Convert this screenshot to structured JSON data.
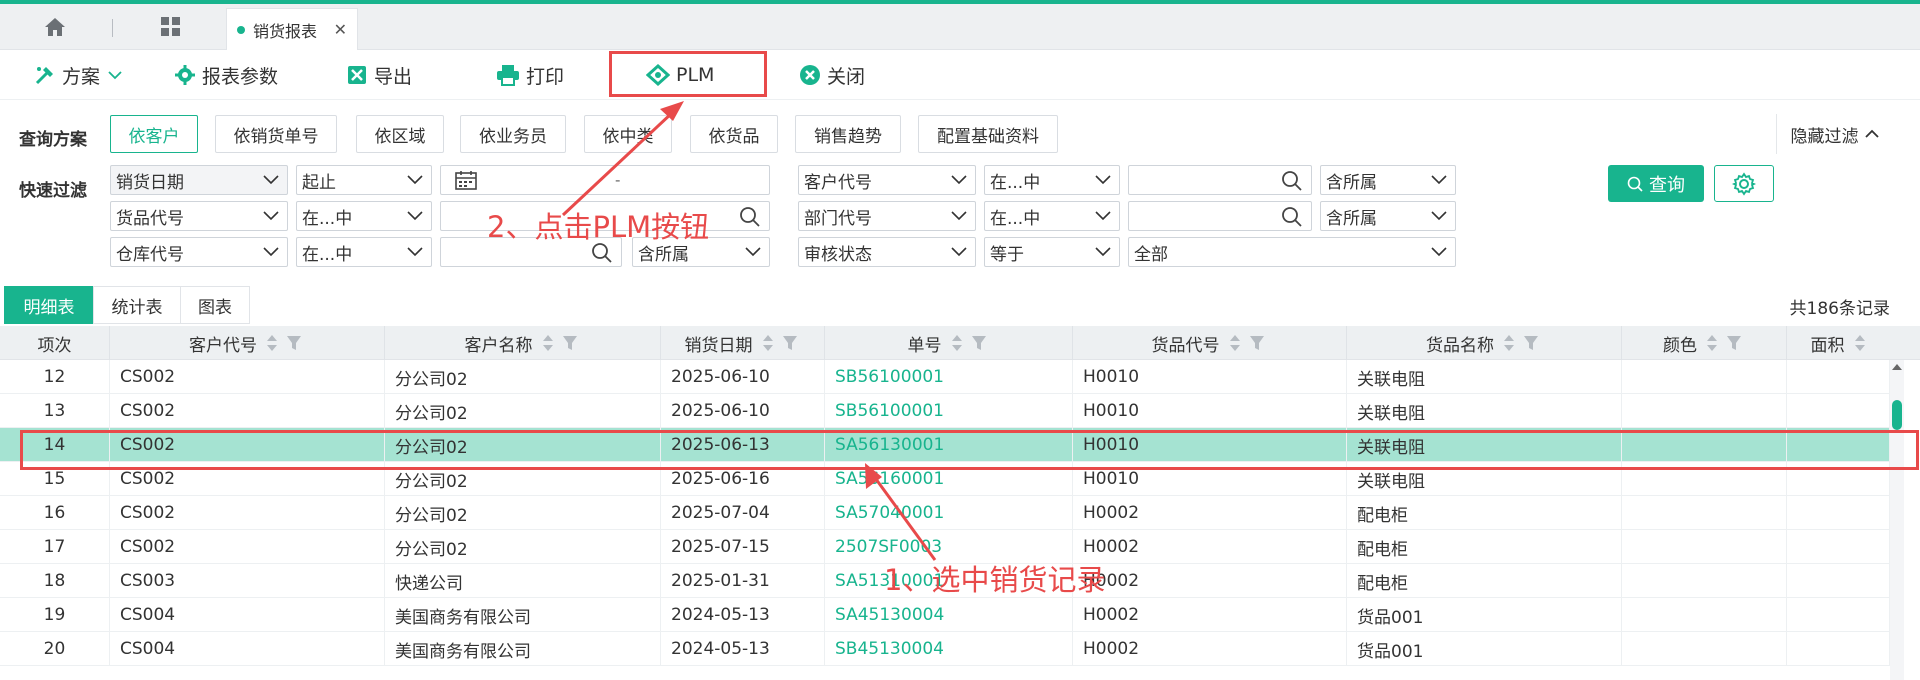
{
  "tabs": {
    "doc_tab_label": "销货报表",
    "close_symbol": "✕"
  },
  "toolbar": {
    "scheme": "方案",
    "report_params": "报表参数",
    "export": "导出",
    "print": "打印",
    "plm": "PLM",
    "close": "关闭"
  },
  "query_scheme": {
    "label": "查询方案",
    "chips": [
      "依客户",
      "依销货单号",
      "依区域",
      "依业务员",
      "依中类",
      "依货品",
      "销售趋势",
      "配置基础资料"
    ],
    "active_index": 0,
    "hide_filter": "隐藏过滤"
  },
  "quick_filter": {
    "label": "快速过滤",
    "row1": {
      "field": "销货日期",
      "op": "起止",
      "date_sep": "-",
      "field2": "客户代号",
      "op2": "在...中",
      "scope2": "含所属"
    },
    "row2": {
      "field": "货品代号",
      "op": "在...中",
      "field2": "部门代号",
      "op2": "在...中",
      "scope2": "含所属"
    },
    "row3": {
      "field": "仓库代号",
      "op": "在...中",
      "scope": "含所属",
      "field2": "审核状态",
      "op2": "等于",
      "value2": "全部"
    },
    "query_button": "查询"
  },
  "view_tabs": [
    "明细表",
    "统计表",
    "图表"
  ],
  "record_count": "共186条记录",
  "columns": [
    "项次",
    "客户代号",
    "客户名称",
    "销货日期",
    "单号",
    "货品代号",
    "货品名称",
    "颜色",
    "面积"
  ],
  "rows": [
    {
      "no": "12",
      "cust_code": "CS002",
      "cust_name": "分公司02",
      "date": "2025-06-10",
      "order_no": "SB56100001",
      "item_code": "H0010",
      "item_name": "关联电阻"
    },
    {
      "no": "13",
      "cust_code": "CS002",
      "cust_name": "分公司02",
      "date": "2025-06-10",
      "order_no": "SB56100001",
      "item_code": "H0010",
      "item_name": "关联电阻"
    },
    {
      "no": "14",
      "cust_code": "CS002",
      "cust_name": "分公司02",
      "date": "2025-06-13",
      "order_no": "SA56130001",
      "item_code": "H0010",
      "item_name": "关联电阻"
    },
    {
      "no": "15",
      "cust_code": "CS002",
      "cust_name": "分公司02",
      "date": "2025-06-16",
      "order_no": "SA56160001",
      "item_code": "H0010",
      "item_name": "关联电阻"
    },
    {
      "no": "16",
      "cust_code": "CS002",
      "cust_name": "分公司02",
      "date": "2025-07-04",
      "order_no": "SA57040001",
      "item_code": "H0002",
      "item_name": "配电柜"
    },
    {
      "no": "17",
      "cust_code": "CS002",
      "cust_name": "分公司02",
      "date": "2025-07-15",
      "order_no": "2507SF0003",
      "item_code": "H0002",
      "item_name": "配电柜"
    },
    {
      "no": "18",
      "cust_code": "CS003",
      "cust_name": "快递公司",
      "date": "2025-01-31",
      "order_no": "SA51310001",
      "item_code": "H0002",
      "item_name": "配电柜"
    },
    {
      "no": "19",
      "cust_code": "CS004",
      "cust_name": "美国商务有限公司",
      "date": "2024-05-13",
      "order_no": "SA45130004",
      "item_code": "H0002",
      "item_name": "货品001"
    },
    {
      "no": "20",
      "cust_code": "CS004",
      "cust_name": "美国商务有限公司",
      "date": "2024-05-13",
      "order_no": "SB45130004",
      "item_code": "H0002",
      "item_name": "货品001"
    }
  ],
  "selected_row_index": 2,
  "annotations": {
    "step1": "1、选中销货记录",
    "step2": "2、点击PLM按钮"
  },
  "colors": {
    "accent": "#18b48e",
    "selected_row": "#a5e3d2",
    "annotation": "#e84a4a"
  }
}
